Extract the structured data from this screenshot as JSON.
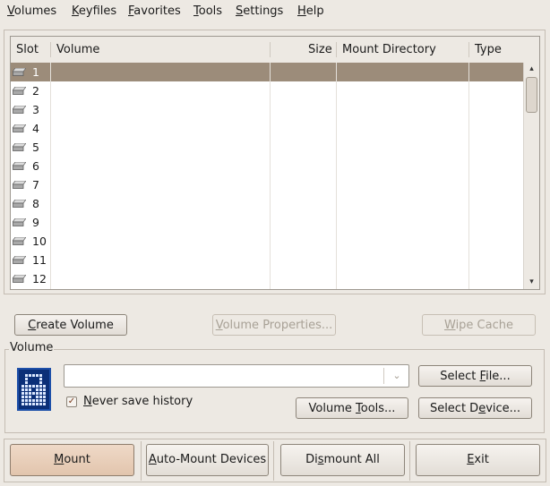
{
  "menubar": {
    "items": [
      {
        "key": "V",
        "rest": "olumes"
      },
      {
        "key": "K",
        "rest": "eyfiles"
      },
      {
        "key": "F",
        "rest": "avorites"
      },
      {
        "key": "T",
        "rest": "ools"
      },
      {
        "key": "S",
        "rest": "ettings"
      },
      {
        "key": "H",
        "rest": "elp"
      }
    ]
  },
  "list": {
    "columns": [
      "Slot",
      "Volume",
      "Size",
      "Mount Directory",
      "Type"
    ],
    "rows": [
      "1",
      "2",
      "3",
      "4",
      "5",
      "6",
      "7",
      "8",
      "9",
      "10",
      "11",
      "12"
    ],
    "selected_index": 0,
    "scroll_up": "▴",
    "scroll_down": "▾"
  },
  "buttons": {
    "create_volume": {
      "key": "C",
      "rest": "reate Volume"
    },
    "volume_properties": {
      "key": "V",
      "rest": "olume Properties..."
    },
    "wipe_cache": {
      "key": "W",
      "rest": "ipe Cache"
    },
    "select_file": {
      "pre": "Select ",
      "key": "F",
      "rest": "ile..."
    },
    "volume_tools": {
      "pre": "Volume ",
      "key": "T",
      "rest": "ools..."
    },
    "select_device": {
      "pre": "Select D",
      "key": "e",
      "rest": "vice..."
    },
    "mount": {
      "pre": "",
      "key": "M",
      "rest": "ount"
    },
    "auto_mount": {
      "pre": "",
      "key": "A",
      "rest": "uto-Mount Devices"
    },
    "dismount_all": {
      "pre": "Di",
      "key": "s",
      "rest": "mount All"
    },
    "exit": {
      "pre": "",
      "key": "E",
      "rest": "xit"
    }
  },
  "volume": {
    "group_label": "Volume",
    "path_value": "",
    "combo_arrow": "⌄",
    "never_save_history": {
      "key": "N",
      "rest": "ever save history",
      "checked": true,
      "mark": "✓"
    }
  },
  "colors": {
    "window_bg": "#ede9e3",
    "selection": "#9c8c7a",
    "check_mark": "#7a3b1c",
    "mount_button": "#e2c5ad"
  }
}
